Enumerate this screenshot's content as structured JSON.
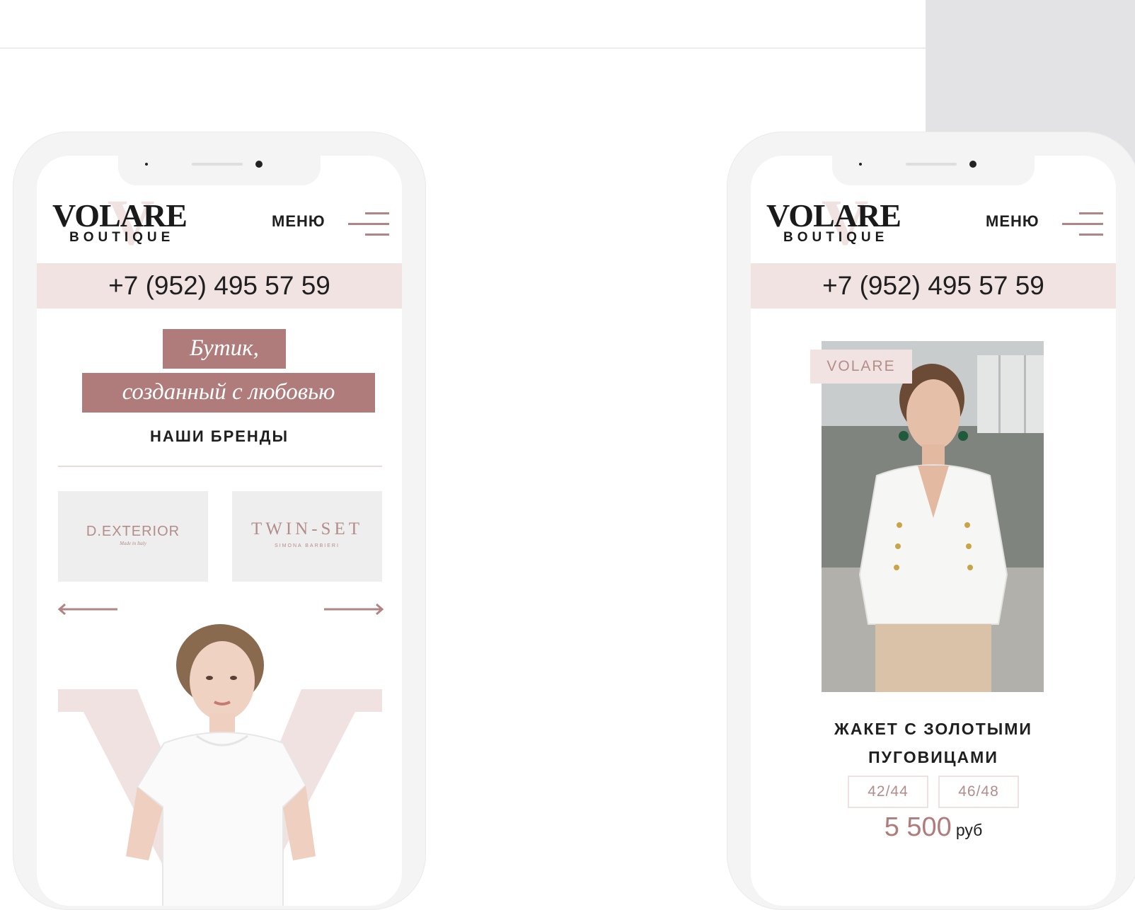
{
  "colors": {
    "accent": "#b07c7b",
    "accent_light": "#f2e3e3",
    "text": "#1f1f1f",
    "phone_frame": "#f4f4f5",
    "right_panel": "#e3e3e6"
  },
  "left_phone": {
    "logo": {
      "main": "VOLARE",
      "sub": "BOUTIQUE",
      "watermark": "V"
    },
    "menu_label": "МЕНЮ",
    "menu_icon": "hamburger-menu-icon",
    "phone_number": "+7 (952) 495 57 59",
    "hero": {
      "line1": "Бутик,",
      "line2": "созданный с любовью"
    },
    "brands_title": "НАШИ БРЕНДЫ",
    "brands": [
      {
        "name": "D.EXTERIOR",
        "sub": "Made in Italy"
      },
      {
        "name": "TWIN-SET",
        "sub": "SIMONA BARBIERI"
      }
    ],
    "carousel": {
      "prev_icon": "arrow-left-icon",
      "next_icon": "arrow-right-icon"
    }
  },
  "right_phone": {
    "logo": {
      "main": "VOLARE",
      "sub": "BOUTIQUE",
      "watermark": "V"
    },
    "menu_label": "МЕНЮ",
    "menu_icon": "hamburger-menu-icon",
    "phone_number": "+7 (952) 495 57 59",
    "product": {
      "badge": "VOLARE",
      "title_line1": "ЖАКЕТ С ЗОЛОТЫМИ",
      "title_line2": "ПУГОВИЦАМИ",
      "sizes": [
        "42/44",
        "46/48"
      ],
      "price": "5 500",
      "currency": "руб"
    }
  }
}
